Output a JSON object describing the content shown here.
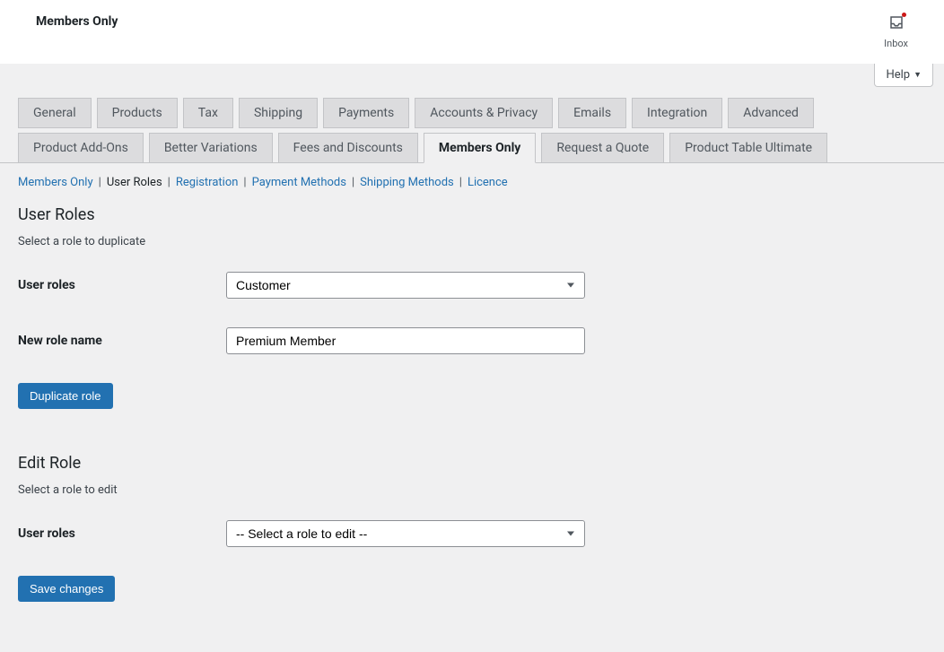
{
  "header": {
    "title": "Members Only",
    "inbox_label": "Inbox"
  },
  "help": {
    "label": "Help"
  },
  "tabs": [
    {
      "label": "General"
    },
    {
      "label": "Products"
    },
    {
      "label": "Tax"
    },
    {
      "label": "Shipping"
    },
    {
      "label": "Payments"
    },
    {
      "label": "Accounts & Privacy"
    },
    {
      "label": "Emails"
    },
    {
      "label": "Integration"
    },
    {
      "label": "Advanced"
    },
    {
      "label": "Product Add-Ons"
    },
    {
      "label": "Better Variations"
    },
    {
      "label": "Fees and Discounts"
    },
    {
      "label": "Members Only"
    },
    {
      "label": "Request a Quote"
    },
    {
      "label": "Product Table Ultimate"
    }
  ],
  "active_tab_index": 12,
  "subnav": [
    {
      "label": "Members Only",
      "current": false
    },
    {
      "label": "User Roles",
      "current": true
    },
    {
      "label": "Registration",
      "current": false
    },
    {
      "label": "Payment Methods",
      "current": false
    },
    {
      "label": "Shipping Methods",
      "current": false
    },
    {
      "label": "Licence",
      "current": false
    }
  ],
  "section1": {
    "heading": "User Roles",
    "subtext": "Select a role to duplicate",
    "user_roles_label": "User roles",
    "user_roles_value": "Customer",
    "new_role_label": "New role name",
    "new_role_value": "Premium Member",
    "duplicate_btn": "Duplicate role"
  },
  "section2": {
    "heading": "Edit Role",
    "subtext": "Select a role to edit",
    "user_roles_label": "User roles",
    "user_roles_value": "-- Select a role to edit --",
    "save_btn": "Save changes"
  }
}
